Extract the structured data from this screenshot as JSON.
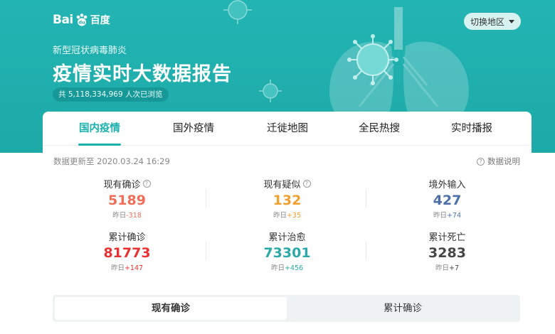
{
  "brand": {
    "logo_text": "Bai",
    "logo_cn": "百度"
  },
  "header": {
    "region_button": "切换地区",
    "subtitle": "新型冠状病毒肺炎",
    "title": "疫情实时大数据报告",
    "views": "共 5,118,334,969 人次已浏览"
  },
  "tabs": [
    {
      "label": "国内疫情",
      "active": true
    },
    {
      "label": "国外疫情"
    },
    {
      "label": "迁徙地图"
    },
    {
      "label": "全民热搜"
    },
    {
      "label": "实时播报"
    }
  ],
  "info": {
    "update_time": "数据更新至 2020.03.24 16:29",
    "explain": "数据说明",
    "help_mark": "?"
  },
  "stats": [
    {
      "label": "现有确诊",
      "value": "5189",
      "delta_prefix": "昨日",
      "delta": "-318",
      "color": "#f06e57",
      "delta_color": "#f06e57",
      "help": true
    },
    {
      "label": "现有疑似",
      "value": "132",
      "delta_prefix": "昨日",
      "delta": "+35",
      "color": "#f0a030",
      "delta_color": "#f0a030",
      "help": true
    },
    {
      "label": "境外输入",
      "value": "427",
      "delta_prefix": "昨日",
      "delta": "+74",
      "color": "#4e6fa8",
      "delta_color": "#4e6fa8"
    },
    {
      "label": "累计确诊",
      "value": "81773",
      "delta_prefix": "昨日",
      "delta": "+147",
      "color": "#e83132",
      "delta_color": "#e83132"
    },
    {
      "label": "累计治愈",
      "value": "73301",
      "delta_prefix": "昨日",
      "delta": "+456",
      "color": "#2ba8a8",
      "delta_color": "#2ba8a8"
    },
    {
      "label": "累计死亡",
      "value": "3283",
      "delta_prefix": "昨日",
      "delta": "+7",
      "color": "#464646",
      "delta_color": "#464646"
    }
  ],
  "segment": [
    {
      "label": "现有确诊",
      "active": true
    },
    {
      "label": "累计确诊"
    }
  ],
  "colors": {
    "accent": "#1cb0ad",
    "banner": "#22b4b3"
  }
}
